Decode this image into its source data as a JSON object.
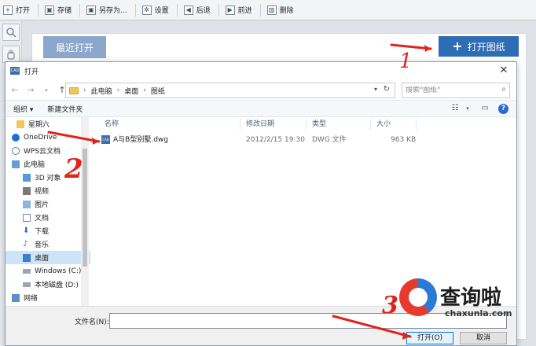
{
  "toolbar": {
    "items": [
      {
        "label": "打开",
        "icon": "plus-icon"
      },
      {
        "label": "存储",
        "icon": "save-icon"
      },
      {
        "label": "另存为...",
        "icon": "save-as-icon"
      },
      {
        "label": "设置",
        "icon": "gear-icon"
      },
      {
        "label": "后退",
        "icon": "back-icon"
      },
      {
        "label": "前进",
        "icon": "forward-icon"
      },
      {
        "label": "删除",
        "icon": "trash-icon"
      }
    ]
  },
  "panel": {
    "recent_tab": "最近打开",
    "open_drawing_button": "打开图纸"
  },
  "dialog": {
    "title": "打开",
    "breadcrumb": [
      "此电脑",
      "桌面",
      "图纸"
    ],
    "search_placeholder": "搜索\"图纸\"",
    "organize": "组织 ▾",
    "new_folder": "新建文件夹",
    "nav_items": [
      {
        "label": "星期六",
        "icon": "folder-icon",
        "child": false
      },
      {
        "label": "OneDrive",
        "icon": "cloud-icon",
        "child": false
      },
      {
        "label": "WPS云文档",
        "icon": "cloud-doc-icon",
        "child": false
      },
      {
        "label": "此电脑",
        "icon": "computer-icon",
        "child": false
      },
      {
        "label": "3D 对象",
        "icon": "cube-icon",
        "child": true
      },
      {
        "label": "视频",
        "icon": "video-icon",
        "child": true
      },
      {
        "label": "图片",
        "icon": "picture-icon",
        "child": true
      },
      {
        "label": "文档",
        "icon": "document-icon",
        "child": true
      },
      {
        "label": "下载",
        "icon": "download-icon",
        "child": true
      },
      {
        "label": "音乐",
        "icon": "music-icon",
        "child": true
      },
      {
        "label": "桌面",
        "icon": "desktop-icon",
        "child": true,
        "selected": true
      },
      {
        "label": "Windows (C:)",
        "icon": "drive-icon",
        "child": true
      },
      {
        "label": "本地磁盘 (D:)",
        "icon": "drive-icon",
        "child": true
      },
      {
        "label": "网络",
        "icon": "network-icon",
        "child": false
      }
    ],
    "columns": [
      "名称",
      "修改日期",
      "类型",
      "大小"
    ],
    "files": [
      {
        "name": "A与B型别墅.dwg",
        "modified": "2012/2/15 19:30",
        "type": "DWG 文件",
        "size": "963 KB"
      }
    ],
    "filename_label": "文件名(N):",
    "filename_value": "",
    "open_button": "打开(O)",
    "cancel_button": "取消"
  },
  "annotations": {
    "num1": "1",
    "num2": "2",
    "num3": "3",
    "arrow_color": "#e0241a"
  },
  "watermark": {
    "text": "查询啦",
    "domain": "chaxunla.com"
  }
}
